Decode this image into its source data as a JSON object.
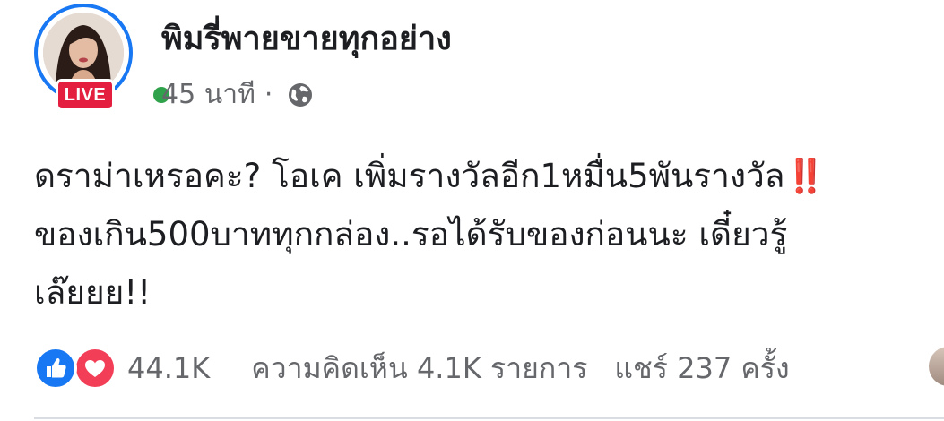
{
  "header": {
    "page_name": "พิมรี่พายขายทุกอย่าง",
    "live_label": "LIVE",
    "time": "45 นาที",
    "separator": "·",
    "privacy_icon": "globe-icon"
  },
  "post": {
    "text_line1": "ดราม่าเหรอคะ? โอเค เพิ่มรางวัลอีก1หมื่น5พันรางวัล",
    "text_bangs": "‼️",
    "text_line2": "ของเกิน500บาททุกกล่อง..รอได้รับของก่อนนะ เดี๋ยวรู้",
    "text_line3": "เล๊ยยย!!"
  },
  "footer": {
    "reaction_icons": [
      "like-icon",
      "love-icon"
    ],
    "reaction_count": "44.1K",
    "comments": "ความคิดเห็น 4.1K รายการ",
    "shares": "แชร์ 237 ครั้ง"
  },
  "colors": {
    "brand_blue": "#1877f2",
    "live_red": "#e41e3f",
    "online_green": "#31a24c",
    "love_red": "#f33e58",
    "secondary_text": "#65676b"
  }
}
